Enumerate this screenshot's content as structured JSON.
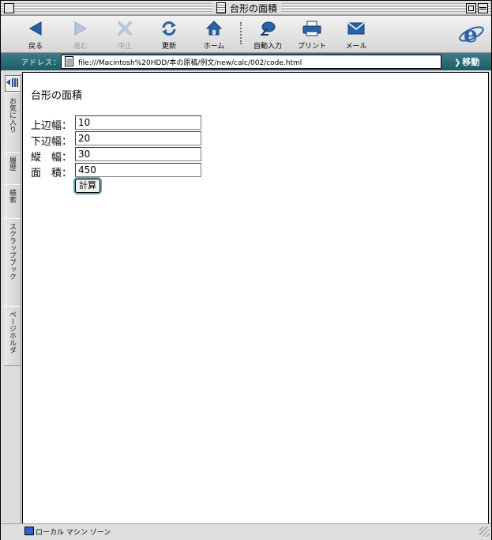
{
  "window": {
    "title": "台形の面積"
  },
  "toolbar": {
    "buttons": [
      {
        "label": "戻る",
        "icon": "back-arrow-icon",
        "enabled": true
      },
      {
        "label": "進む",
        "icon": "forward-arrow-icon",
        "enabled": false
      },
      {
        "label": "中止",
        "icon": "stop-x-icon",
        "enabled": false
      },
      {
        "label": "更新",
        "icon": "refresh-icon",
        "enabled": true
      },
      {
        "label": "ホーム",
        "icon": "home-icon",
        "enabled": true
      },
      {
        "label": "自動入力",
        "icon": "autofill-icon",
        "enabled": true
      },
      {
        "label": "プリント",
        "icon": "printer-icon",
        "enabled": true
      },
      {
        "label": "メール",
        "icon": "mail-icon",
        "enabled": true
      }
    ]
  },
  "address": {
    "label": "アドレス：",
    "url": "file:///Macintosh%20HDD/本の原稿/例文/new/calc/002/code.html",
    "go_label": "移動"
  },
  "sidebar": {
    "tabs": [
      "お気に入り",
      "履歴",
      "検索",
      "スクラップブック",
      "ページホルダ"
    ]
  },
  "page": {
    "heading": "台形の面積",
    "fields": [
      {
        "label": "上辺幅：",
        "value": "10"
      },
      {
        "label": "下辺幅：",
        "value": "20"
      },
      {
        "label": "縦　幅：",
        "value": "30"
      },
      {
        "label": "面　積：",
        "value": "450"
      }
    ],
    "calc_button": "計算"
  },
  "status": {
    "zone_text": "ローカル マシン ゾーン"
  },
  "colors": {
    "address_bar": "#2b6c76",
    "toolbar_icon_blue": "#2a62a8",
    "button_focus_ring": "#6aa6b1"
  }
}
